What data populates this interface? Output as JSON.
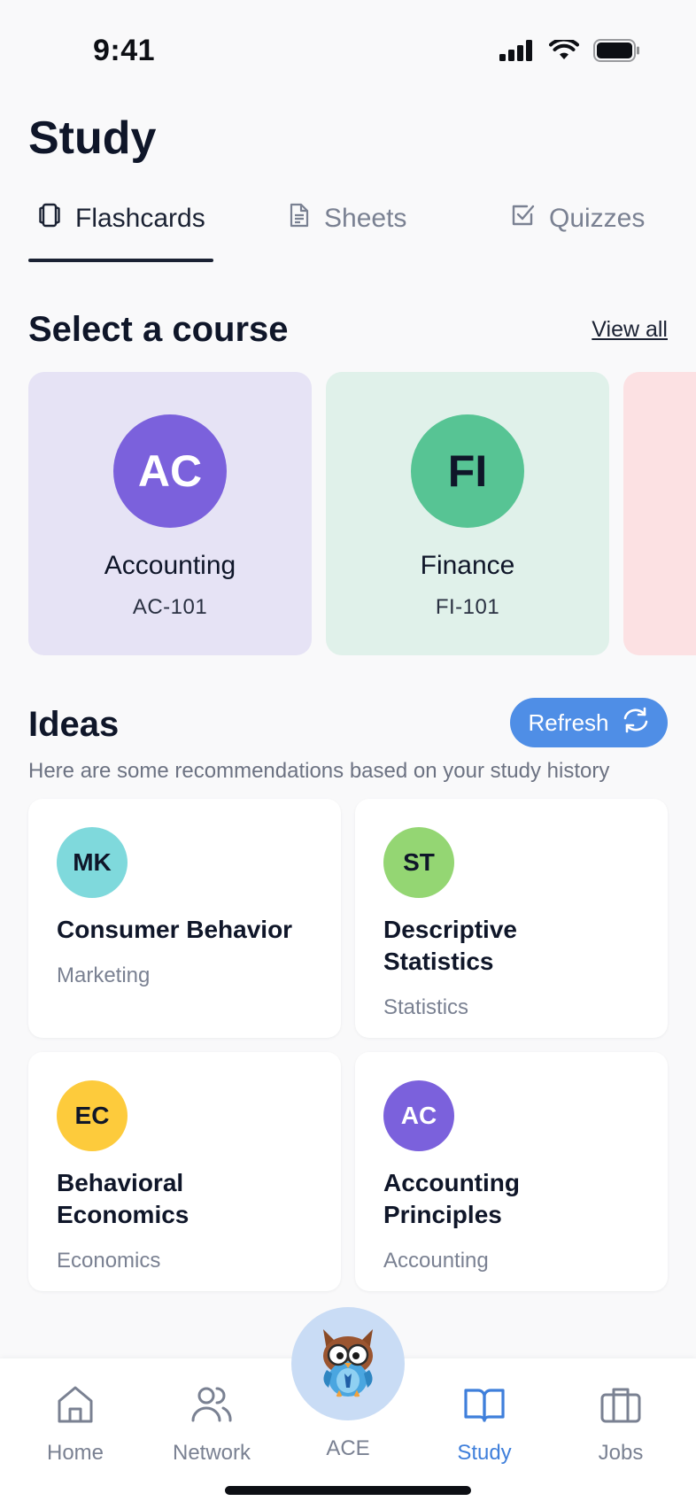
{
  "status_bar": {
    "time": "9:41"
  },
  "page": {
    "title": "Study"
  },
  "tabs": [
    {
      "label": "Flashcards",
      "icon": "flashcards-icon",
      "active": true
    },
    {
      "label": "Sheets",
      "icon": "document-icon",
      "active": false
    },
    {
      "label": "Quizzes",
      "icon": "checkbox-icon",
      "active": false
    }
  ],
  "courses_section": {
    "title": "Select a course",
    "view_all": "View all",
    "courses": [
      {
        "initials": "AC",
        "name": "Accounting",
        "code": "AC-101",
        "card_bg": "#e6e3f5",
        "avatar_bg": "#7b61dc",
        "avatar_fg": "#ffffff"
      },
      {
        "initials": "FI",
        "name": "Finance",
        "code": "FI-101",
        "card_bg": "#e0f1ea",
        "avatar_bg": "#57c494",
        "avatar_fg": "#0f1629"
      },
      {
        "initials": "",
        "name": "",
        "code": "",
        "card_bg": "#fce1e3",
        "avatar_bg": "",
        "avatar_fg": ""
      }
    ]
  },
  "ideas_section": {
    "title": "Ideas",
    "refresh_label": "Refresh",
    "subtitle": "Here are some recommendations based on your  study history",
    "items": [
      {
        "initials": "MK",
        "title": "Consumer Behavior",
        "subject": "Marketing",
        "avatar_bg": "#7fd9dc"
      },
      {
        "initials": "ST",
        "title": "Descriptive Statistics",
        "subject": "Statistics",
        "avatar_bg": "#94d673"
      },
      {
        "initials": "EC",
        "title": "Behavioral Economics",
        "subject": "Economics",
        "avatar_bg": "#fdcb3c"
      },
      {
        "initials": "AC",
        "title": "Accounting Principles",
        "subject": "Accounting",
        "avatar_bg": "#7b61dc"
      }
    ]
  },
  "bottom_nav": [
    {
      "label": "Home",
      "icon": "home-icon",
      "active": false
    },
    {
      "label": "Network",
      "icon": "users-icon",
      "active": false
    },
    {
      "label": "ACE",
      "icon": "owl-mascot-icon",
      "active": false
    },
    {
      "label": "Study",
      "icon": "book-open-icon",
      "active": true
    },
    {
      "label": "Jobs",
      "icon": "briefcase-icon",
      "active": false
    }
  ],
  "colors": {
    "accent": "#3f7fdb",
    "refresh_button": "#4f8ee6",
    "text_primary": "#0f1629",
    "text_muted": "#7a8192"
  }
}
